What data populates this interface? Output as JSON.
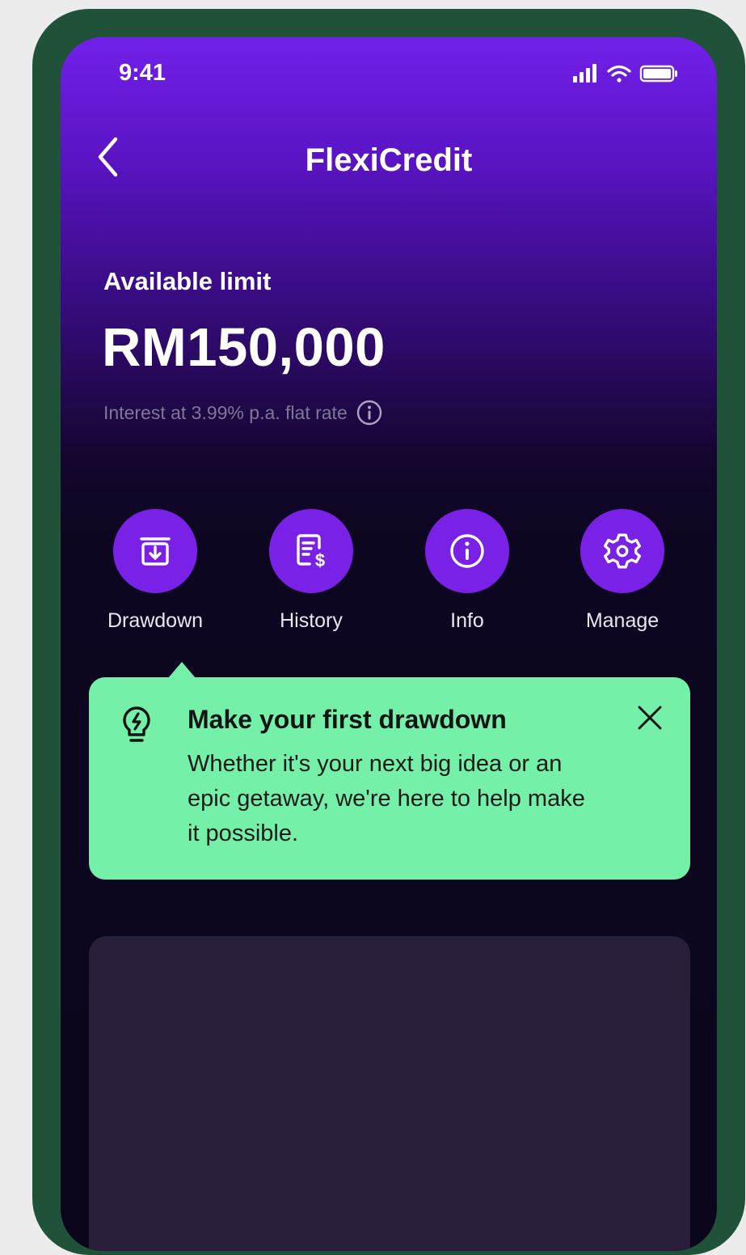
{
  "status_bar": {
    "time": "9:41",
    "icons": [
      "signal-icon",
      "wifi-icon",
      "battery-icon"
    ]
  },
  "header": {
    "title": "FlexiCredit",
    "back_icon": "back-chevron-icon"
  },
  "limit": {
    "label": "Available limit",
    "amount": "RM150,000",
    "interest_text": "Interest at 3.99% p.a. flat rate",
    "interest_icon": "info-circle-icon"
  },
  "actions": [
    {
      "label": "Drawdown",
      "icon": "drawdown-icon"
    },
    {
      "label": "History",
      "icon": "history-icon"
    },
    {
      "label": "Info",
      "icon": "info-icon"
    },
    {
      "label": "Manage",
      "icon": "gear-icon"
    }
  ],
  "tip": {
    "icon": "lightbulb-icon",
    "title": "Make your first drawdown",
    "body": "Whether it's your next big idea or an epic getaway, we're here to help make it possible.",
    "close_icon": "close-icon"
  },
  "colors": {
    "frame": "#20523a",
    "accent": "#7a21e8",
    "tip_background": "#74f0a8",
    "card_background": "#2a1f3a"
  }
}
